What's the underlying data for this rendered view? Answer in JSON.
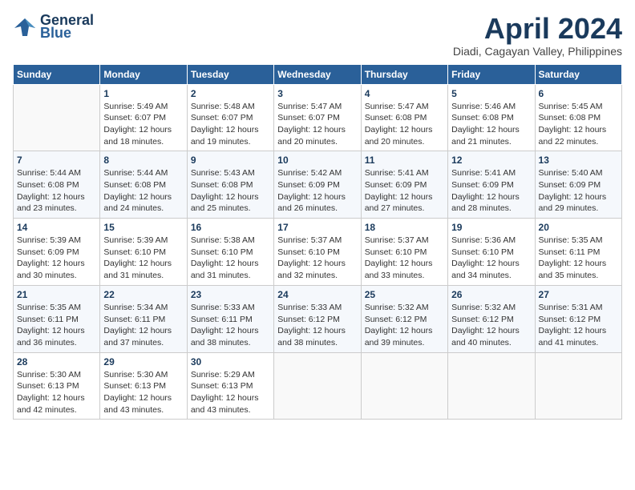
{
  "header": {
    "logo_line1": "General",
    "logo_line2": "Blue",
    "title": "April 2024",
    "location": "Diadi, Cagayan Valley, Philippines"
  },
  "weekdays": [
    "Sunday",
    "Monday",
    "Tuesday",
    "Wednesday",
    "Thursday",
    "Friday",
    "Saturday"
  ],
  "weeks": [
    [
      {
        "day": "",
        "info": ""
      },
      {
        "day": "1",
        "info": "Sunrise: 5:49 AM\nSunset: 6:07 PM\nDaylight: 12 hours\nand 18 minutes."
      },
      {
        "day": "2",
        "info": "Sunrise: 5:48 AM\nSunset: 6:07 PM\nDaylight: 12 hours\nand 19 minutes."
      },
      {
        "day": "3",
        "info": "Sunrise: 5:47 AM\nSunset: 6:07 PM\nDaylight: 12 hours\nand 20 minutes."
      },
      {
        "day": "4",
        "info": "Sunrise: 5:47 AM\nSunset: 6:08 PM\nDaylight: 12 hours\nand 20 minutes."
      },
      {
        "day": "5",
        "info": "Sunrise: 5:46 AM\nSunset: 6:08 PM\nDaylight: 12 hours\nand 21 minutes."
      },
      {
        "day": "6",
        "info": "Sunrise: 5:45 AM\nSunset: 6:08 PM\nDaylight: 12 hours\nand 22 minutes."
      }
    ],
    [
      {
        "day": "7",
        "info": "Sunrise: 5:44 AM\nSunset: 6:08 PM\nDaylight: 12 hours\nand 23 minutes."
      },
      {
        "day": "8",
        "info": "Sunrise: 5:44 AM\nSunset: 6:08 PM\nDaylight: 12 hours\nand 24 minutes."
      },
      {
        "day": "9",
        "info": "Sunrise: 5:43 AM\nSunset: 6:08 PM\nDaylight: 12 hours\nand 25 minutes."
      },
      {
        "day": "10",
        "info": "Sunrise: 5:42 AM\nSunset: 6:09 PM\nDaylight: 12 hours\nand 26 minutes."
      },
      {
        "day": "11",
        "info": "Sunrise: 5:41 AM\nSunset: 6:09 PM\nDaylight: 12 hours\nand 27 minutes."
      },
      {
        "day": "12",
        "info": "Sunrise: 5:41 AM\nSunset: 6:09 PM\nDaylight: 12 hours\nand 28 minutes."
      },
      {
        "day": "13",
        "info": "Sunrise: 5:40 AM\nSunset: 6:09 PM\nDaylight: 12 hours\nand 29 minutes."
      }
    ],
    [
      {
        "day": "14",
        "info": "Sunrise: 5:39 AM\nSunset: 6:09 PM\nDaylight: 12 hours\nand 30 minutes."
      },
      {
        "day": "15",
        "info": "Sunrise: 5:39 AM\nSunset: 6:10 PM\nDaylight: 12 hours\nand 31 minutes."
      },
      {
        "day": "16",
        "info": "Sunrise: 5:38 AM\nSunset: 6:10 PM\nDaylight: 12 hours\nand 31 minutes."
      },
      {
        "day": "17",
        "info": "Sunrise: 5:37 AM\nSunset: 6:10 PM\nDaylight: 12 hours\nand 32 minutes."
      },
      {
        "day": "18",
        "info": "Sunrise: 5:37 AM\nSunset: 6:10 PM\nDaylight: 12 hours\nand 33 minutes."
      },
      {
        "day": "19",
        "info": "Sunrise: 5:36 AM\nSunset: 6:10 PM\nDaylight: 12 hours\nand 34 minutes."
      },
      {
        "day": "20",
        "info": "Sunrise: 5:35 AM\nSunset: 6:11 PM\nDaylight: 12 hours\nand 35 minutes."
      }
    ],
    [
      {
        "day": "21",
        "info": "Sunrise: 5:35 AM\nSunset: 6:11 PM\nDaylight: 12 hours\nand 36 minutes."
      },
      {
        "day": "22",
        "info": "Sunrise: 5:34 AM\nSunset: 6:11 PM\nDaylight: 12 hours\nand 37 minutes."
      },
      {
        "day": "23",
        "info": "Sunrise: 5:33 AM\nSunset: 6:11 PM\nDaylight: 12 hours\nand 38 minutes."
      },
      {
        "day": "24",
        "info": "Sunrise: 5:33 AM\nSunset: 6:12 PM\nDaylight: 12 hours\nand 38 minutes."
      },
      {
        "day": "25",
        "info": "Sunrise: 5:32 AM\nSunset: 6:12 PM\nDaylight: 12 hours\nand 39 minutes."
      },
      {
        "day": "26",
        "info": "Sunrise: 5:32 AM\nSunset: 6:12 PM\nDaylight: 12 hours\nand 40 minutes."
      },
      {
        "day": "27",
        "info": "Sunrise: 5:31 AM\nSunset: 6:12 PM\nDaylight: 12 hours\nand 41 minutes."
      }
    ],
    [
      {
        "day": "28",
        "info": "Sunrise: 5:30 AM\nSunset: 6:13 PM\nDaylight: 12 hours\nand 42 minutes."
      },
      {
        "day": "29",
        "info": "Sunrise: 5:30 AM\nSunset: 6:13 PM\nDaylight: 12 hours\nand 43 minutes."
      },
      {
        "day": "30",
        "info": "Sunrise: 5:29 AM\nSunset: 6:13 PM\nDaylight: 12 hours\nand 43 minutes."
      },
      {
        "day": "",
        "info": ""
      },
      {
        "day": "",
        "info": ""
      },
      {
        "day": "",
        "info": ""
      },
      {
        "day": "",
        "info": ""
      }
    ]
  ]
}
